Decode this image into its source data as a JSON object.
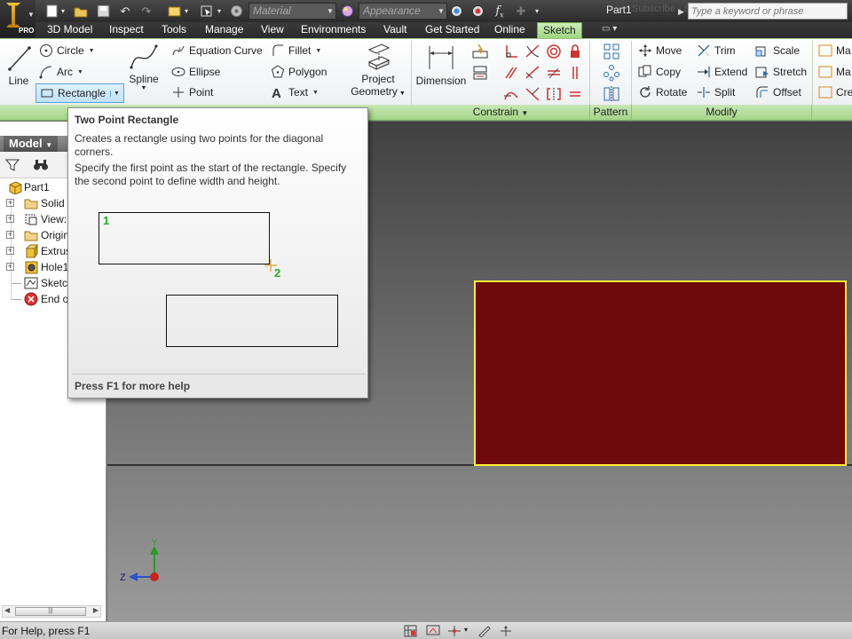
{
  "quick_access": {
    "material_combo": "Material",
    "appearance_combo": "Appearance",
    "fx_symbol": "f",
    "fx_subscript": "x"
  },
  "title": {
    "document": "Part1",
    "ghost_text": "Subscribe - Sketch Pro..."
  },
  "search": {
    "placeholder": "Type a keyword or phrase"
  },
  "app_logo": {
    "badge": "PRO"
  },
  "tabs": [
    {
      "label": "3D Model"
    },
    {
      "label": "Inspect"
    },
    {
      "label": "Tools"
    },
    {
      "label": "Manage"
    },
    {
      "label": "View"
    },
    {
      "label": "Environments"
    },
    {
      "label": "Vault"
    },
    {
      "label": "Get Started"
    },
    {
      "label": "Online"
    },
    {
      "label": "Sketch"
    }
  ],
  "ribbon": {
    "draw": {
      "line": "Line",
      "circle": "Circle",
      "arc": "Arc",
      "rectangle": "Rectangle",
      "spline": "Spline",
      "equation_curve": "Equation Curve",
      "ellipse": "Ellipse",
      "point": "Point",
      "fillet": "Fillet",
      "polygon": "Polygon",
      "text": "Text",
      "project_geometry_1": "Project",
      "project_geometry_2": "Geometry"
    },
    "constrain": {
      "dimension": "Dimension",
      "panel_title": "Constrain"
    },
    "pattern": {
      "panel_title": "Pattern"
    },
    "modify": {
      "move": "Move",
      "copy": "Copy",
      "rotate": "Rotate",
      "trim": "Trim",
      "extend": "Extend",
      "split": "Split",
      "scale": "Scale",
      "stretch": "Stretch",
      "offset": "Offset",
      "panel_title": "Modify"
    },
    "layout": {
      "item1": "Ma",
      "item2": "Ma",
      "item3": "Cre"
    }
  },
  "browser": {
    "title": "Model",
    "items": [
      {
        "label": "Part1"
      },
      {
        "label": "Solid B"
      },
      {
        "label": "View:"
      },
      {
        "label": "Origin"
      },
      {
        "label": "Extrus"
      },
      {
        "label": "Hole1"
      },
      {
        "label": "Sketch"
      },
      {
        "label": "End of"
      }
    ]
  },
  "tooltip": {
    "title": "Two Point Rectangle",
    "description": "Creates a rectangle using two points for the diagonal corners.",
    "details": "Specify the first point as the start of the rectangle. Specify the second point to define width and height.",
    "point1": "1",
    "point2": "2",
    "footer": "Press F1 for more help"
  },
  "triad": {
    "y_label": "Y",
    "z_label": "Z"
  },
  "status": {
    "text": "For Help, press F1"
  },
  "colors": {
    "active_tab": "#b5e39b",
    "sketch_face": "#6e0a0a",
    "sketch_outline": "#ffee33",
    "tooltip_point_label": "#28a828"
  }
}
